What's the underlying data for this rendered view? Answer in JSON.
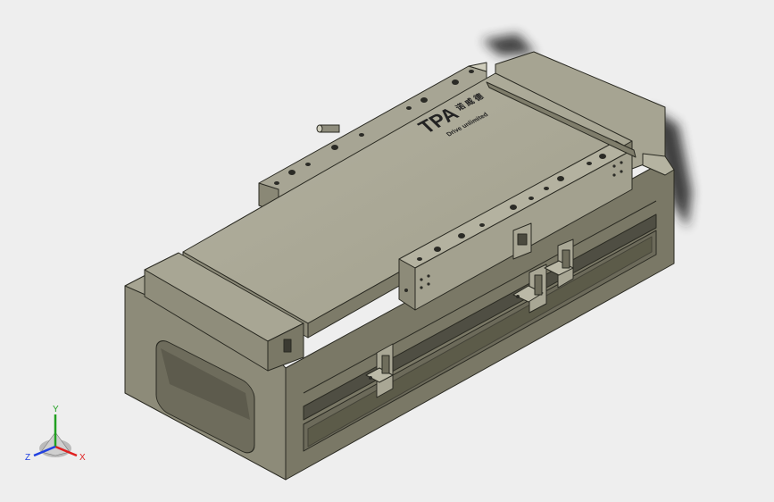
{
  "model": {
    "logo_mark": "TPA",
    "logo_chinese": "诺 威 德",
    "logo_subtitle": "Drive unlimited"
  },
  "triad": {
    "x_label": "X",
    "y_label": "Y",
    "z_label": "Z",
    "x_color": "#e02020",
    "y_color": "#20a020",
    "z_color": "#2040e0"
  },
  "colors": {
    "background": "#eeeeee",
    "body_top": "#aaa897",
    "body_side": "#8d8b79",
    "body_dark": "#5b5a4d",
    "edge": "#2a2a22"
  }
}
